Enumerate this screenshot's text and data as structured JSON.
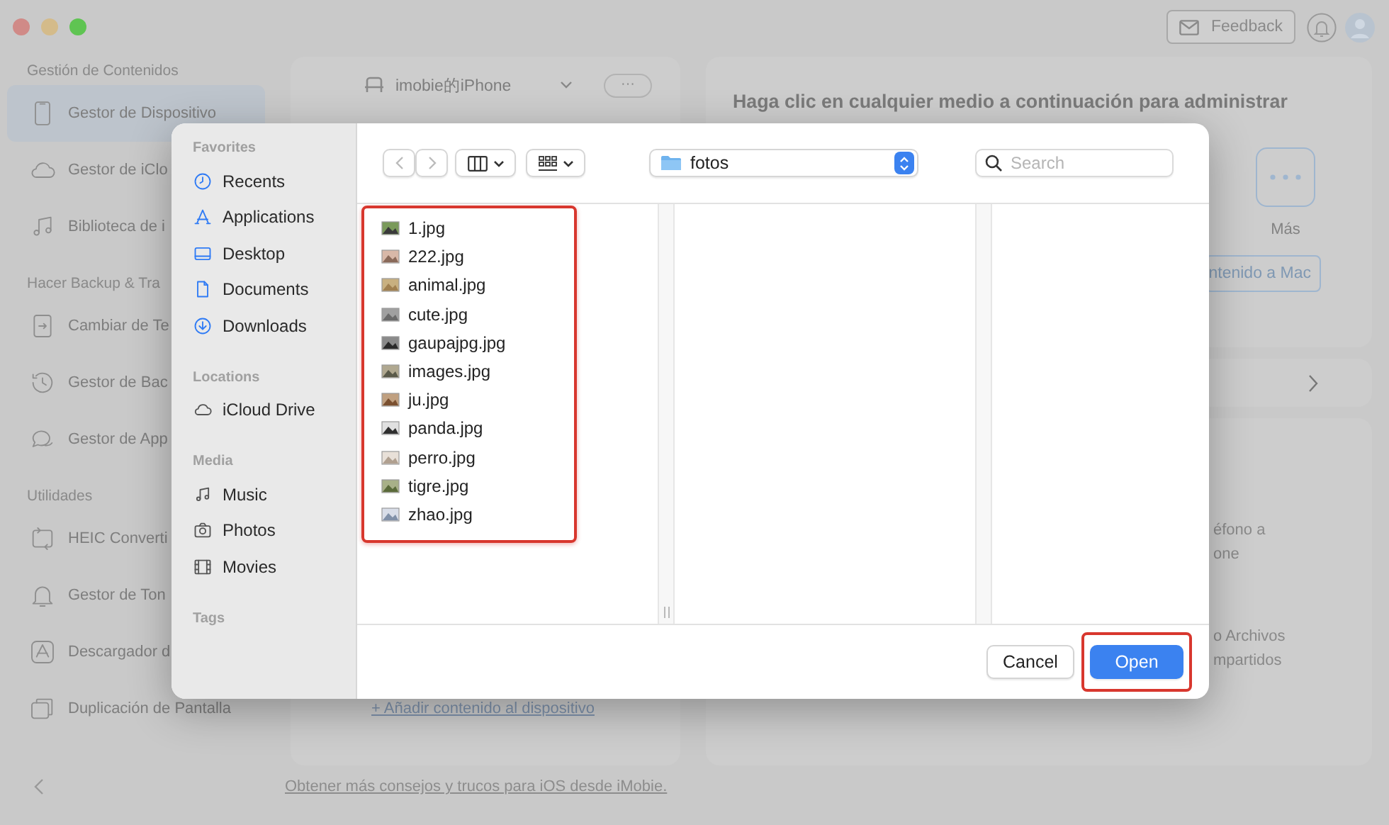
{
  "window": {
    "controls": [
      {
        "kind": "close"
      },
      {
        "kind": "minimize"
      },
      {
        "kind": "zoom"
      }
    ]
  },
  "toolbar": {
    "feedback": "Feedback"
  },
  "sidebar": {
    "sections": [
      {
        "title": "Gestión de Contenidos",
        "items": [
          {
            "label": "Gestor de Dispositivo",
            "kind": "phone",
            "selected": true
          },
          {
            "label": "Gestor de iClo",
            "kind": "cloud",
            "selected": false
          },
          {
            "label": "Biblioteca de i",
            "kind": "music",
            "selected": false
          }
        ]
      },
      {
        "title": "Hacer Backup & Tra",
        "items": [
          {
            "label": "Cambiar de Te",
            "kind": "switch",
            "selected": false
          },
          {
            "label": "Gestor de Bac",
            "kind": "history",
            "selected": false
          },
          {
            "label": "Gestor de App",
            "kind": "chat",
            "selected": false
          }
        ]
      },
      {
        "title": "Utilidades",
        "items": [
          {
            "label": "HEIC Converti",
            "kind": "heic",
            "selected": false
          },
          {
            "label": "Gestor de Ton",
            "kind": "bell",
            "selected": false
          },
          {
            "label": "Descargador d",
            "kind": "appstore",
            "selected": false
          },
          {
            "label": "Duplicación de Pantalla",
            "kind": "screens",
            "selected": false
          }
        ]
      }
    ]
  },
  "device_card": {
    "device": "imobie的iPhone",
    "more": "···",
    "add_link": "+ Añadir contenido al dispositivo"
  },
  "media_card": {
    "heading": "Haga clic en cualquier medio a continuación para administrar",
    "more_label": "Más",
    "export_button": "ntenido a Mac"
  },
  "transfer_card": {
    "blocks": [
      [
        "éfono a",
        "one"
      ],
      [
        "o Archivos",
        "mpartidos"
      ]
    ]
  },
  "footer": {
    "tips_link": "Obtener más consejos y trucos para iOS desde iMobie."
  },
  "dialog": {
    "sidebar": [
      {
        "title": "Favorites",
        "items": [
          {
            "label": "Recents",
            "kind": "clock"
          },
          {
            "label": "Applications",
            "kind": "apps"
          },
          {
            "label": "Desktop",
            "kind": "desktop"
          },
          {
            "label": "Documents",
            "kind": "document"
          },
          {
            "label": "Downloads",
            "kind": "download"
          }
        ]
      },
      {
        "title": "Locations",
        "items": [
          {
            "label": "iCloud Drive",
            "kind": "cloud"
          }
        ]
      },
      {
        "title": "Media",
        "items": [
          {
            "label": "Music",
            "kind": "music"
          },
          {
            "label": "Photos",
            "kind": "camera"
          },
          {
            "label": "Movies",
            "kind": "film"
          }
        ]
      },
      {
        "title": "Tags"
      }
    ],
    "path": "fotos",
    "search": {
      "placeholder": "Search"
    },
    "files": {
      "highlighted": true,
      "items": [
        "1.jpg",
        "222.jpg",
        "animal.jpg",
        "cute.jpg",
        "gaupajpg.jpg",
        "images.jpg",
        "ju.jpg",
        "panda.jpg",
        "perro.jpg",
        "tigre.jpg",
        "zhao.jpg"
      ]
    },
    "buttons": [
      {
        "label": "Cancel",
        "default": false,
        "highlighted": false
      },
      {
        "label": "Open",
        "default": true,
        "highlighted": true
      }
    ]
  }
}
